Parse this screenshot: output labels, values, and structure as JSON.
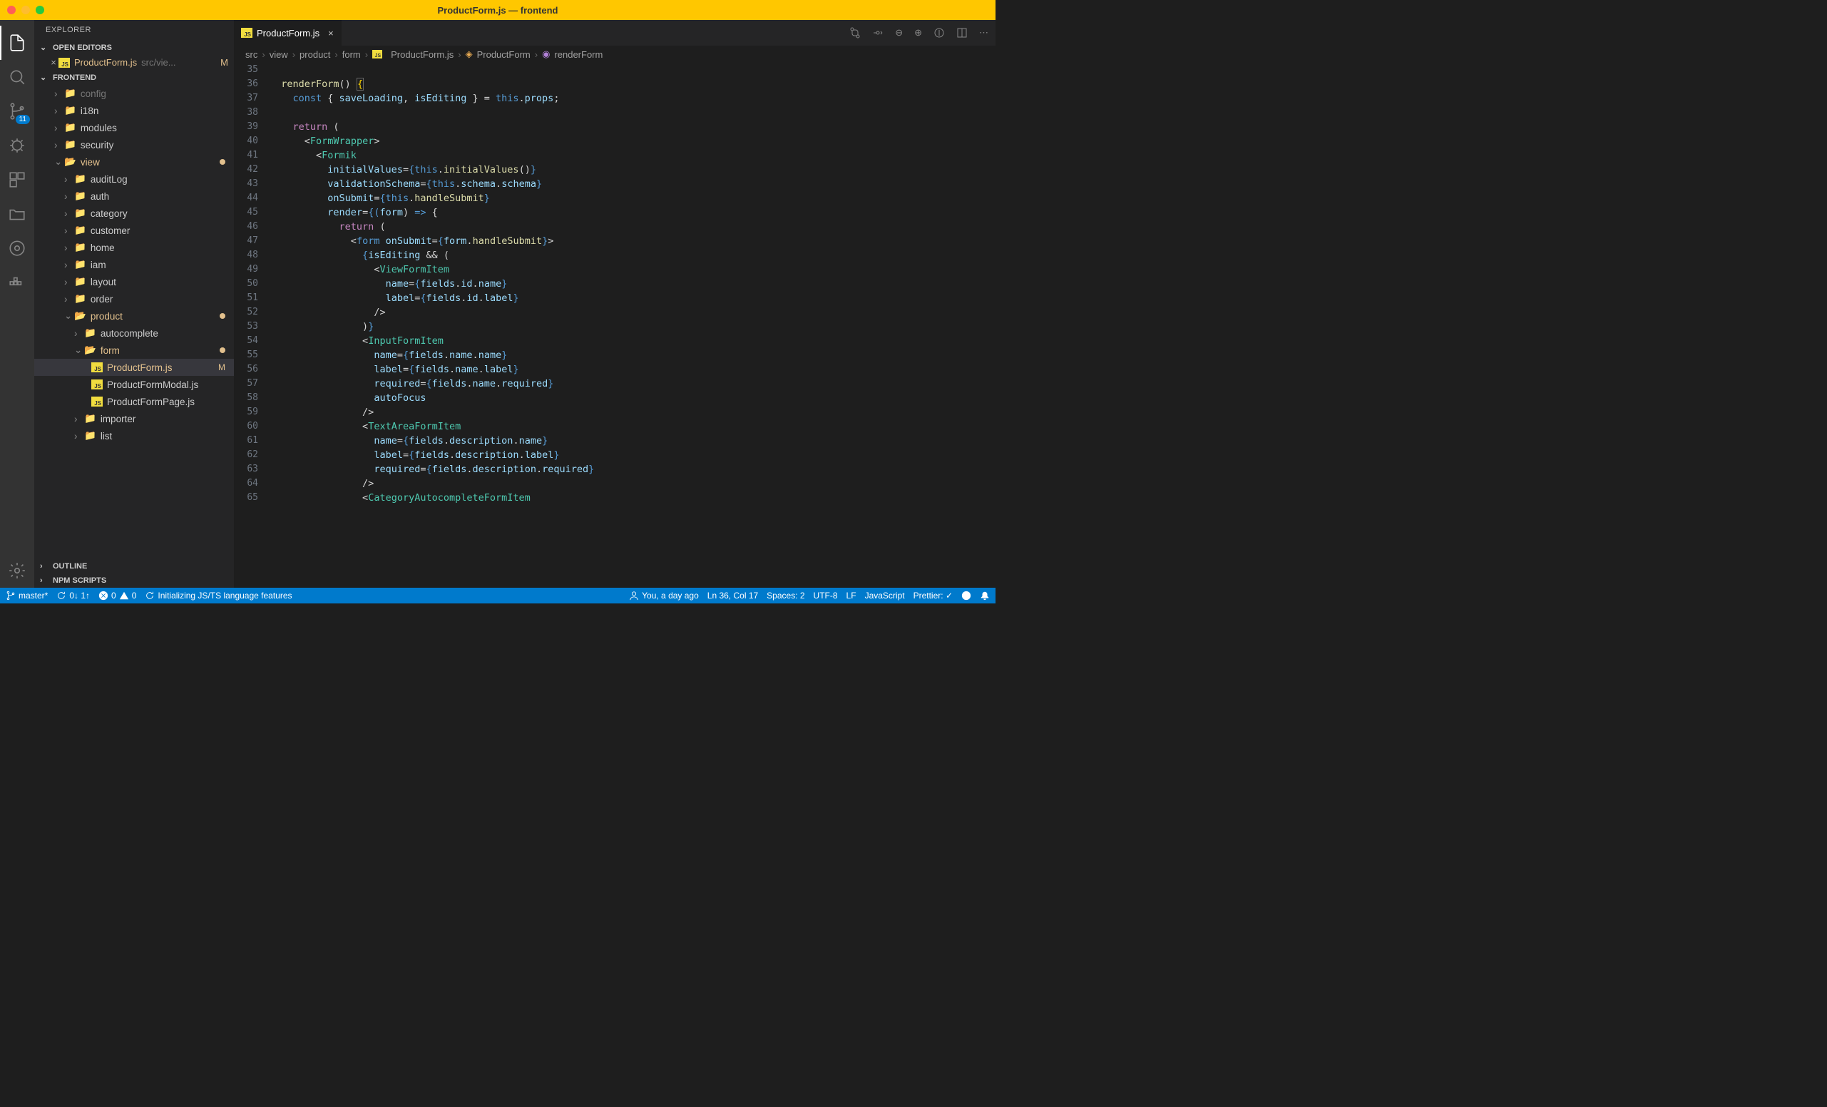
{
  "window": {
    "title": "ProductForm.js — frontend"
  },
  "activity": {
    "scm_badge": "11"
  },
  "sidebar": {
    "title": "EXPLORER",
    "sections": {
      "open_editors": "OPEN EDITORS",
      "workspace": "FRONTEND",
      "outline": "OUTLINE",
      "npm": "NPM SCRIPTS"
    },
    "open_editor": {
      "file": "ProductForm.js",
      "path": "src/vie...",
      "mod": "M"
    },
    "tree": {
      "config": "config",
      "i18n": "i18n",
      "modules": "modules",
      "security": "security",
      "view": "view",
      "auditLog": "auditLog",
      "auth": "auth",
      "category": "category",
      "customer": "customer",
      "home": "home",
      "iam": "iam",
      "layout": "layout",
      "order": "order",
      "product": "product",
      "autocomplete": "autocomplete",
      "form": "form",
      "ProductForm": "ProductForm.js",
      "ProductFormModal": "ProductFormModal.js",
      "ProductFormPage": "ProductFormPage.js",
      "importer": "importer",
      "list": "list"
    }
  },
  "tab": {
    "file": "ProductForm.js"
  },
  "breadcrumbs": {
    "b1": "src",
    "b2": "view",
    "b3": "product",
    "b4": "form",
    "b5": "ProductForm.js",
    "b6": "ProductForm",
    "b7": "renderForm"
  },
  "gutter": {
    "start": 35,
    "end": 65
  },
  "code": {
    "l36": {
      "a": "renderForm",
      "b": "() ",
      "c": "{"
    },
    "l37": {
      "a": "const",
      "b": " { ",
      "c": "saveLoading",
      "d": ", ",
      "e": "isEditing",
      "f": " } = ",
      "g": "this",
      "h": ".",
      "i": "props",
      "j": ";"
    },
    "l39": {
      "a": "return",
      "b": " ("
    },
    "l40": {
      "a": "<",
      "b": "FormWrapper",
      "c": ">"
    },
    "l41": {
      "a": "<",
      "b": "Formik"
    },
    "l42": {
      "a": "initialValues",
      "b": "=",
      "c": "{",
      "d": "this",
      "e": ".",
      "f": "initialValues",
      "g": "()",
      "h": "}"
    },
    "l43": {
      "a": "validationSchema",
      "b": "=",
      "c": "{",
      "d": "this",
      "e": ".",
      "f": "schema",
      "g": ".",
      "h": "schema",
      "i": "}"
    },
    "l44": {
      "a": "onSubmit",
      "b": "=",
      "c": "{",
      "d": "this",
      "e": ".",
      "f": "handleSubmit",
      "g": "}"
    },
    "l45": {
      "a": "render",
      "b": "=",
      "c": "{(",
      "d": "form",
      "e": ") ",
      "f": "=>",
      "g": " {"
    },
    "l46": {
      "a": "return",
      "b": " ("
    },
    "l47": {
      "a": "<",
      "b": "form",
      "c": " ",
      "d": "onSubmit",
      "e": "=",
      "f": "{",
      "g": "form",
      "h": ".",
      "i": "handleSubmit",
      "j": "}",
      "k": ">"
    },
    "l48": {
      "a": "{",
      "b": "isEditing",
      "c": " && ("
    },
    "l49": {
      "a": "<",
      "b": "ViewFormItem"
    },
    "l50": {
      "a": "name",
      "b": "=",
      "c": "{",
      "d": "fields",
      "e": ".",
      "f": "id",
      "g": ".",
      "h": "name",
      "i": "}"
    },
    "l51": {
      "a": "label",
      "b": "=",
      "c": "{",
      "d": "fields",
      "e": ".",
      "f": "id",
      "g": ".",
      "h": "label",
      "i": "}"
    },
    "l52": {
      "a": "/>"
    },
    "l53": {
      "a": ")",
      "b": "}"
    },
    "l54": {
      "a": "<",
      "b": "InputFormItem"
    },
    "l55": {
      "a": "name",
      "b": "=",
      "c": "{",
      "d": "fields",
      "e": ".",
      "f": "name",
      "g": ".",
      "h": "name",
      "i": "}"
    },
    "l56": {
      "a": "label",
      "b": "=",
      "c": "{",
      "d": "fields",
      "e": ".",
      "f": "name",
      "g": ".",
      "h": "label",
      "i": "}"
    },
    "l57": {
      "a": "required",
      "b": "=",
      "c": "{",
      "d": "fields",
      "e": ".",
      "f": "name",
      "g": ".",
      "h": "required",
      "i": "}"
    },
    "l58": {
      "a": "autoFocus"
    },
    "l59": {
      "a": "/>"
    },
    "l60": {
      "a": "<",
      "b": "TextAreaFormItem"
    },
    "l61": {
      "a": "name",
      "b": "=",
      "c": "{",
      "d": "fields",
      "e": ".",
      "f": "description",
      "g": ".",
      "h": "name",
      "i": "}"
    },
    "l62": {
      "a": "label",
      "b": "=",
      "c": "{",
      "d": "fields",
      "e": ".",
      "f": "description",
      "g": ".",
      "h": "label",
      "i": "}"
    },
    "l63": {
      "a": "required",
      "b": "=",
      "c": "{",
      "d": "fields",
      "e": ".",
      "f": "description",
      "g": ".",
      "h": "required",
      "i": "}"
    },
    "l64": {
      "a": "/>"
    },
    "l65": {
      "a": "<",
      "b": "CategoryAutocompleteFormItem"
    }
  },
  "status": {
    "branch": "master*",
    "sync": "0↓ 1↑",
    "errors": "0",
    "warnings": "0",
    "init": "Initializing JS/TS language features",
    "blame": "You, a day ago",
    "cursor": "Ln 36, Col 17",
    "spaces": "Spaces: 2",
    "encoding": "UTF-8",
    "eol": "LF",
    "lang": "JavaScript",
    "prettier": "Prettier: ✓"
  }
}
